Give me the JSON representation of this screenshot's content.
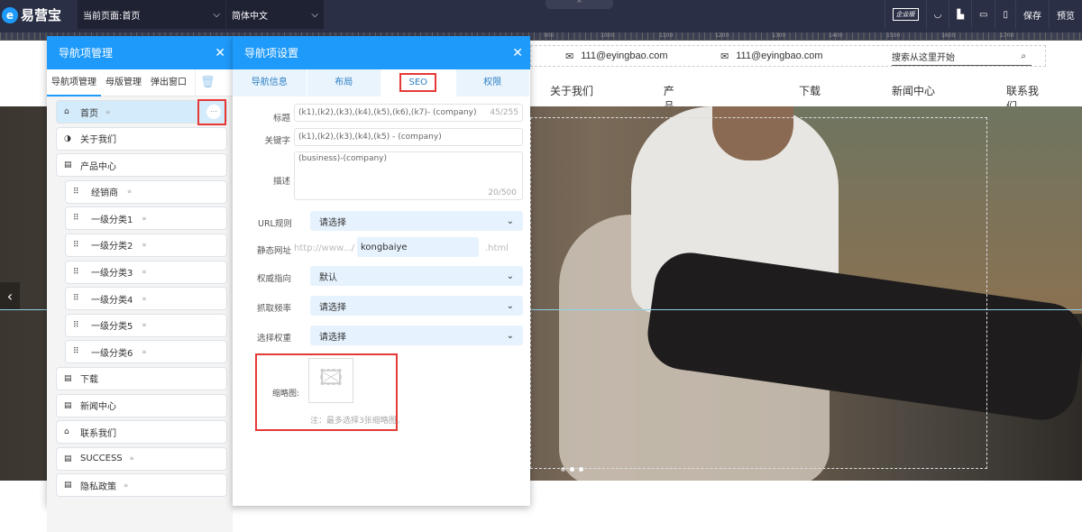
{
  "topbar": {
    "logo": "易营宝",
    "current_page": "当前页面:首页",
    "language": "简体中文",
    "edition_badge": "企业版",
    "save": "保存",
    "preview": "预览"
  },
  "ruler": [
    "900",
    "1000",
    "1100",
    "1200",
    "1300",
    "1400",
    "1500",
    "1600",
    "1700"
  ],
  "site": {
    "email1": "111@eyingbao.com",
    "email2": "111@eyingbao.com",
    "search_placeholder": "搜索从这里开始",
    "nav": [
      "关于我们",
      "产品中心",
      "下载",
      "新闻中心",
      "联系我们"
    ]
  },
  "nav_manager": {
    "title": "导航项管理",
    "tabs": [
      "导航项管理",
      "母版管理",
      "弹出窗口"
    ],
    "items": [
      {
        "label": "首页",
        "icon": "⌂",
        "level": 0
      },
      {
        "label": "关于我们",
        "icon": "◑",
        "level": 0
      },
      {
        "label": "产品中心",
        "icon": "▤",
        "level": 0
      },
      {
        "label": "经销商",
        "icon": "⠿",
        "level": 1
      },
      {
        "label": "一级分类1",
        "icon": "⠿",
        "level": 1
      },
      {
        "label": "一级分类2",
        "icon": "⠿",
        "level": 1
      },
      {
        "label": "一级分类3",
        "icon": "⠿",
        "level": 1
      },
      {
        "label": "一级分类4",
        "icon": "⠿",
        "level": 1
      },
      {
        "label": "一级分类5",
        "icon": "⠿",
        "level": 1
      },
      {
        "label": "一级分类6",
        "icon": "⠿",
        "level": 1
      },
      {
        "label": "下载",
        "icon": "▤",
        "level": 0
      },
      {
        "label": "新闻中心",
        "icon": "▤",
        "level": 0
      },
      {
        "label": "联系我们",
        "icon": "⌂",
        "level": 0
      },
      {
        "label": "SUCCESS",
        "icon": "▤",
        "level": 0
      },
      {
        "label": "隐私政策",
        "icon": "▤",
        "level": 0
      }
    ]
  },
  "nav_settings": {
    "title": "导航项设置",
    "tabs": [
      "导航信息",
      "布局",
      "SEO",
      "权限"
    ],
    "seo": {
      "title_label": "标题",
      "title_value": "(k1),(k2),(k3),(k4),(k5),(k6),(k7)- (company)",
      "title_count": "45/255",
      "keywords_label": "关键字",
      "keywords_value": "(k1),(k2),(k3),(k4),(k5) - (company)",
      "desc_label": "描述",
      "desc_value": "(business)-(company)",
      "desc_count": "20/500",
      "url_rule_label": "URL规则",
      "url_rule_value": "请选择",
      "static_label": "静态网址",
      "static_prefix": "http://www.../",
      "static_value": "kongbaiye",
      "static_suffix": ".html",
      "canonical_label": "权威指向",
      "canonical_value": "默认",
      "crawl_label": "抓取频率",
      "crawl_value": "请选择",
      "weight_label": "选择权重",
      "weight_value": "请选择",
      "thumb_label": "缩略图:",
      "thumb_note": "注：最多选择3张缩略图。"
    }
  }
}
